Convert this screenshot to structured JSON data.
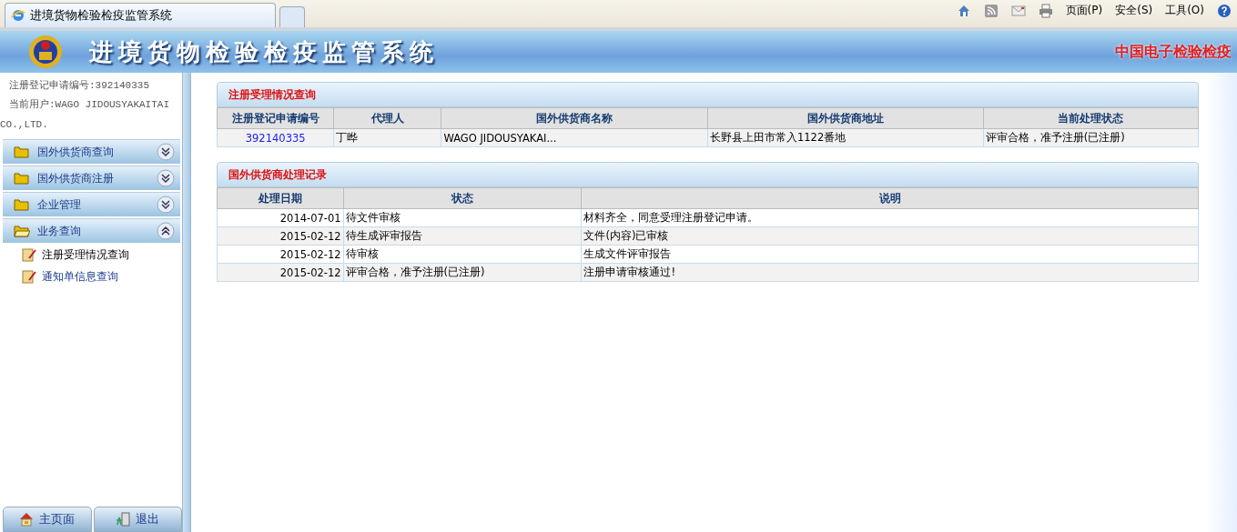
{
  "browser": {
    "tab_title": "进境货物检验检疫监管系统",
    "toolbar": [
      {
        "kind": "home"
      },
      {
        "kind": "feed"
      },
      {
        "kind": "mail"
      },
      {
        "kind": "print"
      },
      {
        "kind": "text",
        "label": "页面(P)"
      },
      {
        "kind": "text",
        "label": "安全(S)"
      },
      {
        "kind": "text",
        "label": "工具(O)"
      },
      {
        "kind": "help"
      }
    ]
  },
  "banner": {
    "title": "进境货物检验检疫监管系统",
    "brand": "中国电子检验检疫"
  },
  "sidebar": {
    "info": [
      "注册登记申请编号:392140335",
      "当前用户:WAGO JIDOUSYAKAITAI CO.,LTD."
    ],
    "groups": [
      {
        "label": "国外供货商查询",
        "expanded": false
      },
      {
        "label": "国外供货商注册",
        "expanded": false
      },
      {
        "label": "企业管理",
        "expanded": false
      },
      {
        "label": "业务查询",
        "expanded": true,
        "children": [
          {
            "label": "注册受理情况查询",
            "selected": true
          },
          {
            "label": "通知单信息查询",
            "selected": false
          }
        ]
      }
    ],
    "footer": [
      {
        "kind": "home",
        "label": "主页面"
      },
      {
        "kind": "exit",
        "label": "退出"
      }
    ]
  },
  "panels": [
    {
      "kind": "application",
      "title": "注册受理情况查询",
      "columns": [
        "注册登记申请编号",
        "代理人",
        "国外供货商名称",
        "国外供货商地址",
        "当前处理状态"
      ],
      "rows": [
        [
          "392140335",
          "丁晔",
          "WAGO JIDOUSYAKAI...",
          "长野县上田市常入1122番地",
          "评审合格，准予注册(已注册)"
        ]
      ]
    },
    {
      "kind": "records",
      "title": "国外供货商处理记录",
      "columns": [
        "处理日期",
        "状态",
        "说明"
      ],
      "rows": [
        [
          "2014-07-01",
          "待文件审核",
          "材料齐全，同意受理注册登记申请。"
        ],
        [
          "2015-02-12",
          "待生成评审报告",
          "文件(内容)已审核"
        ],
        [
          "2015-02-12",
          "待审核",
          "生成文件评审报告"
        ],
        [
          "2015-02-12",
          "评审合格，准予注册(已注册)",
          "注册申请审核通过!"
        ]
      ]
    }
  ]
}
